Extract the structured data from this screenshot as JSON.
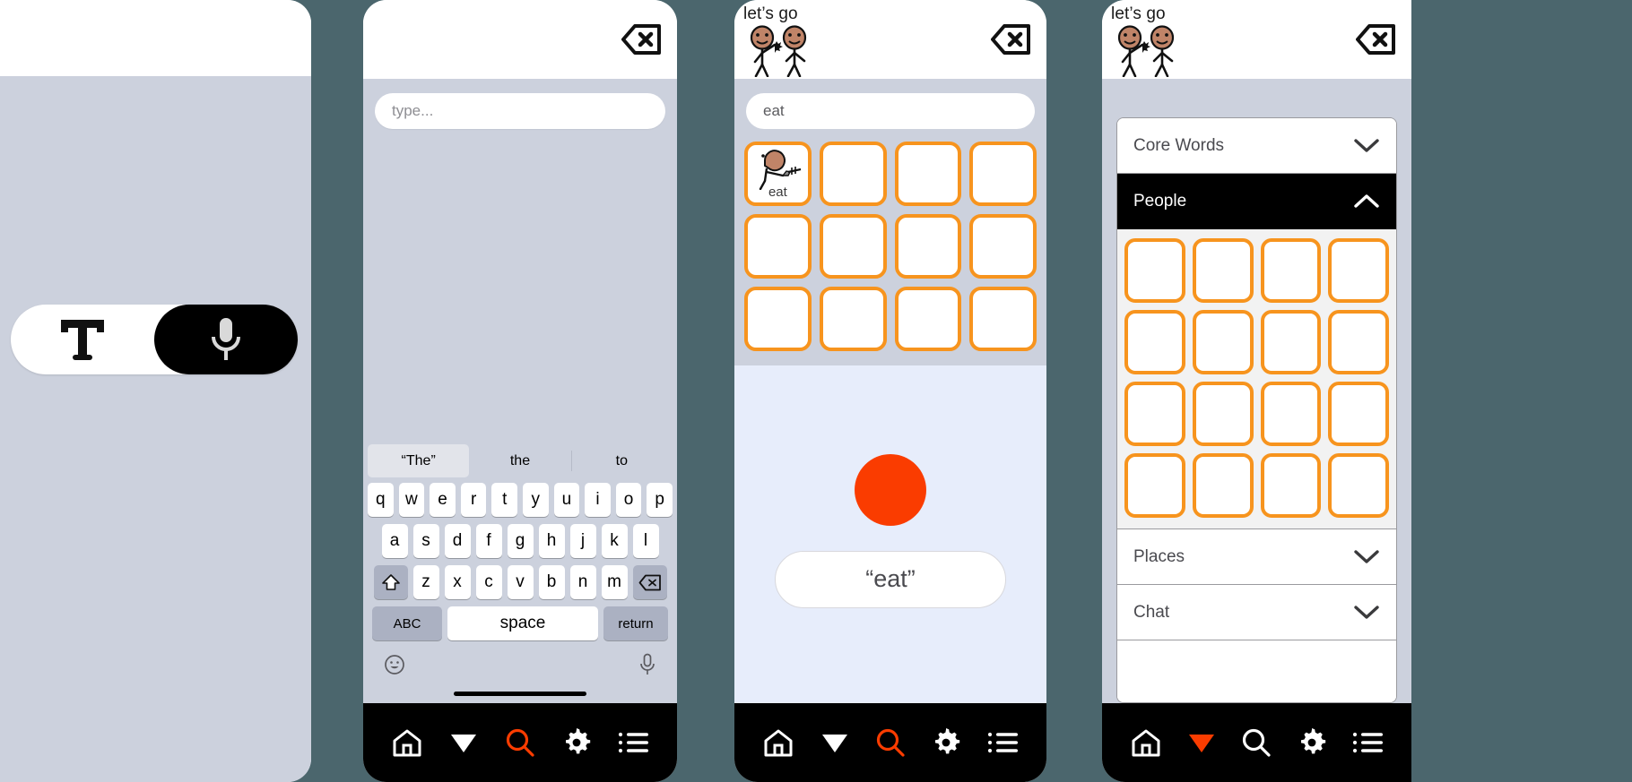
{
  "accent": {
    "orange": "#f7941e",
    "red_orange": "#fa3c00",
    "black": "#000000",
    "grey_bg": "#ccd1dd",
    "speak_bg": "#e7edfb",
    "backdrop": "#4b666d"
  },
  "panel1": {
    "name": "mode-selection-screen",
    "toggle": {
      "text_mode_icon": "text-T-icon",
      "voice_mode_icon": "microphone-icon",
      "active": "voice"
    }
  },
  "panel2": {
    "name": "keyboard-screen",
    "header": {
      "backspace_icon": "backspace-delete-icon"
    },
    "input": {
      "value": "",
      "placeholder": "type..."
    },
    "predictions": [
      {
        "label": "“The”",
        "selected": true
      },
      {
        "label": "the",
        "selected": false
      },
      {
        "label": "to",
        "selected": false
      }
    ],
    "keyboard": {
      "row1": [
        "q",
        "w",
        "e",
        "r",
        "t",
        "y",
        "u",
        "i",
        "o",
        "p"
      ],
      "row2": [
        "a",
        "s",
        "d",
        "f",
        "g",
        "h",
        "j",
        "k",
        "l"
      ],
      "row3": [
        "z",
        "x",
        "c",
        "v",
        "b",
        "n",
        "m"
      ],
      "shift_icon": "shift-arrow-icon",
      "backspace_icon": "backspace-delete-icon",
      "abc_label": "ABC",
      "space_label": "space",
      "return_label": "return",
      "emoji_icon": "emoji-smiley-icon",
      "dictation_icon": "microphone-icon"
    },
    "navbar": {
      "items": [
        {
          "icon": "home-icon",
          "active": false
        },
        {
          "icon": "chevron-down-triangle-icon",
          "active": false
        },
        {
          "icon": "search-icon",
          "active": true
        },
        {
          "icon": "gear-icon",
          "active": false
        },
        {
          "icon": "list-menu-icon",
          "active": false
        }
      ]
    }
  },
  "panel3": {
    "name": "word-grid-screen",
    "header": {
      "caption": "let’s go",
      "art": "two-stick-figures-waving-icon",
      "backspace_icon": "backspace-delete-icon"
    },
    "input": {
      "value": "eat",
      "placeholder": "type..."
    },
    "grid": {
      "rows": 3,
      "cols": 4,
      "cells": [
        {
          "label": "eat",
          "art": "person-eating-icon"
        },
        {
          "label": "",
          "art": ""
        },
        {
          "label": "",
          "art": ""
        },
        {
          "label": "",
          "art": ""
        },
        {
          "label": "",
          "art": ""
        },
        {
          "label": "",
          "art": ""
        },
        {
          "label": "",
          "art": ""
        },
        {
          "label": "",
          "art": ""
        },
        {
          "label": "",
          "art": ""
        },
        {
          "label": "",
          "art": ""
        },
        {
          "label": "",
          "art": ""
        },
        {
          "label": "",
          "art": ""
        }
      ]
    },
    "speak": {
      "record_button": "record-circle-button",
      "spoken_text": "“eat”"
    },
    "navbar": {
      "items": [
        {
          "icon": "home-icon",
          "active": false
        },
        {
          "icon": "chevron-down-triangle-icon",
          "active": false
        },
        {
          "icon": "search-icon",
          "active": true
        },
        {
          "icon": "gear-icon",
          "active": false
        },
        {
          "icon": "list-menu-icon",
          "active": false
        }
      ]
    }
  },
  "panel4": {
    "name": "category-browser-screen",
    "header": {
      "caption": "let’s go",
      "art": "two-stick-figures-waving-icon",
      "backspace_icon": "backspace-delete-icon"
    },
    "accordion": [
      {
        "label": "Core Words",
        "open": false,
        "chevron": "chevron-down-icon"
      },
      {
        "label": "People",
        "open": true,
        "chevron": "chevron-up-icon",
        "cells_rows": 4,
        "cells_cols": 4,
        "cells_count": 16
      },
      {
        "label": "Places",
        "open": false,
        "chevron": "chevron-down-icon"
      },
      {
        "label": "Chat",
        "open": false,
        "chevron": "chevron-down-icon"
      }
    ],
    "navbar": {
      "items": [
        {
          "icon": "home-icon",
          "active": false
        },
        {
          "icon": "chevron-down-triangle-icon",
          "active": true
        },
        {
          "icon": "search-icon",
          "active": false
        },
        {
          "icon": "gear-icon",
          "active": false
        },
        {
          "icon": "list-menu-icon",
          "active": false
        }
      ]
    }
  }
}
